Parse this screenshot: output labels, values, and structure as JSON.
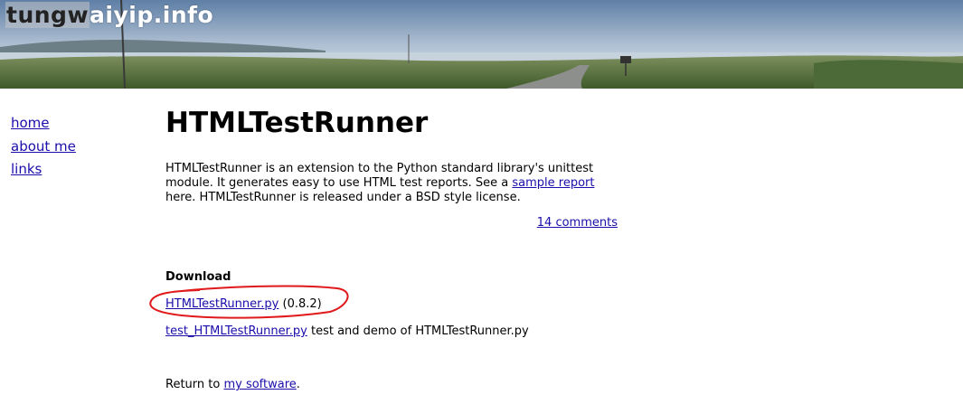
{
  "site": {
    "title_part1": "tungw",
    "title_part2": "aiyip.info"
  },
  "nav": {
    "items": [
      "home",
      "about me",
      "links"
    ]
  },
  "main": {
    "title": "HTMLTestRunner",
    "intro_text_1": "HTMLTestRunner is an extension to the Python standard library's unittest module. It generates easy to use HTML test reports. See a ",
    "intro_link": "sample report",
    "intro_text_2": " here. HTMLTestRunner is released under a BSD style license.",
    "comments_link": "14 comments",
    "download_heading": "Download",
    "download_1_link": "HTMLTestRunner.py",
    "download_1_version": " (0.8.2)",
    "download_2_link": "test_HTMLTestRunner.py",
    "download_2_desc": " test and demo of HTMLTestRunner.py",
    "return_text": "Return to ",
    "return_link": "my software",
    "return_end": "."
  },
  "colors": {
    "link": "#1a0dab",
    "annotation": "#e0191b"
  }
}
